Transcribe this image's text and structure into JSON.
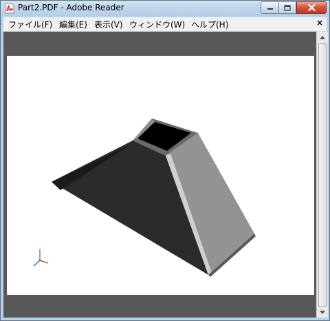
{
  "window": {
    "title": "Part2.PDF - Adobe Reader"
  },
  "menubar": {
    "items": [
      {
        "label": "ファイル(F)"
      },
      {
        "label": "編集(E)"
      },
      {
        "label": "表示(V)"
      },
      {
        "label": "ウィンドウ(W)"
      },
      {
        "label": "ヘルプ(H)"
      }
    ],
    "close_label": "×"
  },
  "document": {
    "model": "truncated-pyramid-shell",
    "triad_colors": {
      "x": "#d4262a",
      "y": "#2c9a3e",
      "z": "#3b50c9"
    }
  },
  "colors": {
    "title_bar": "#c2d7ec",
    "viewer_background": "#585858",
    "page_background": "#ffffff",
    "close_button": "#d6573f"
  }
}
